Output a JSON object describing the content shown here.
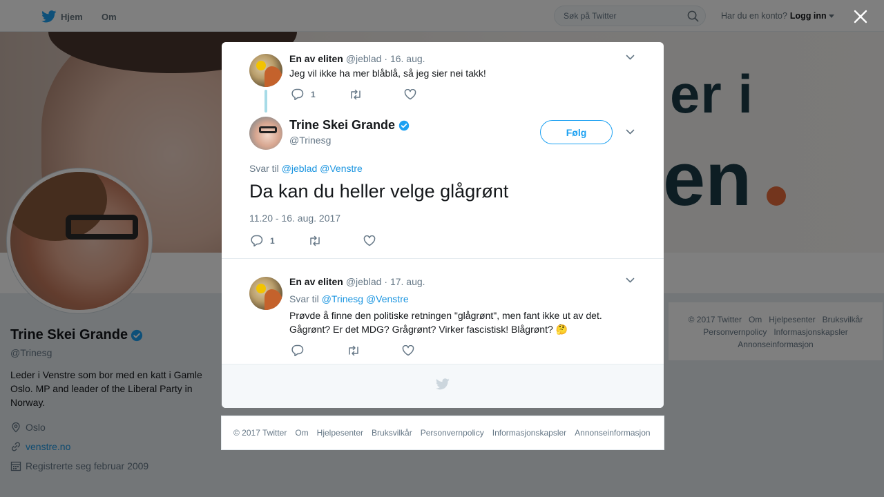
{
  "topnav": {
    "home_label": "Hjem",
    "about_label": "Om",
    "search_placeholder": "Søk på Twitter",
    "login_question": "Har du en konto?",
    "login_label": "Logg inn"
  },
  "banner": {
    "word1": "er i",
    "word2": "en"
  },
  "profile": {
    "name": "Trine Skei Grande",
    "handle": "@Trinesg",
    "bio": "Leder i Venstre som bor med en katt i Gamle Oslo. MP and leader of the Liberal Party in Norway.",
    "location": "Oslo",
    "website": "venstre.no",
    "joined": "Registrerte seg februar 2009"
  },
  "side_footer": {
    "links": [
      "© 2017 Twitter",
      "Om",
      "Hjelpesenter",
      "Bruksvilkår",
      "Personvernpolicy",
      "Informasjonskapsler",
      "Annonseinformasjon"
    ]
  },
  "modal": {
    "parent_tweet": {
      "name": "En av eliten",
      "handle": "@jeblad",
      "date": "· 16. aug.",
      "text": "Jeg vil ikke ha mer blåblå, så jeg sier nei takk!",
      "reply_count": "1"
    },
    "main_tweet": {
      "name": "Trine Skei Grande",
      "handle": "@Trinesg",
      "follow_label": "Følg",
      "replying_prefix": "Svar til",
      "mention1": "@jeblad",
      "mention2": "@Venstre",
      "text": "Da kan du heller velge glågrønt",
      "timestamp": "11.20 - 16. aug. 2017",
      "reply_count": "1"
    },
    "reply_tweet": {
      "name": "En av eliten",
      "handle": "@jeblad",
      "date": "· 17. aug.",
      "replying_prefix": "Svar til",
      "mention1": "@Trinesg",
      "mention2": "@Venstre",
      "text": "Prøvde å finne den politiske retningen \"glågrønt\", men fant ikke ut av det. Gågrønt? Er det MDG? Grågrønt? Virker fascistisk! Blågrønt? 🤔"
    }
  },
  "bottom_footer": {
    "links": [
      "© 2017 Twitter",
      "Om",
      "Hjelpesenter",
      "Bruksvilkår",
      "Personvernpolicy",
      "Informasjonskapsler",
      "Annonseinformasjon"
    ]
  },
  "colors": {
    "twitter_blue": "#1da1f2",
    "link_blue": "#1b95e0",
    "muted": "#657786",
    "thread_line": "#a7dbe7"
  }
}
